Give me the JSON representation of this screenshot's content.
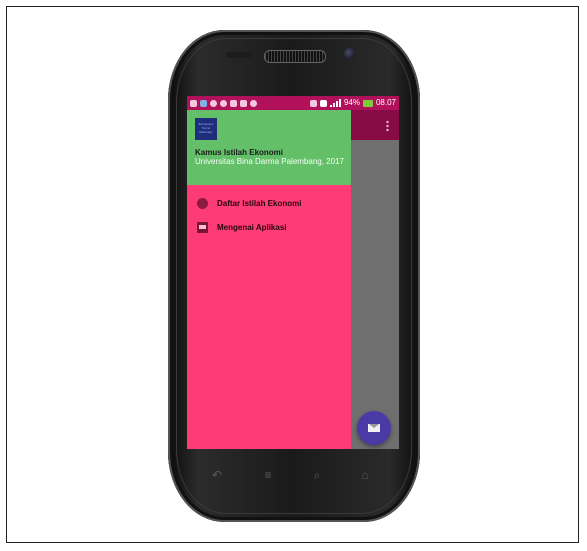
{
  "status_bar": {
    "battery": "94%",
    "time": "08.07",
    "icons": [
      "message-icon",
      "app-icon",
      "chat-icon",
      "bubble-icon",
      "mail-icon",
      "mail-icon",
      "instagram-icon",
      "vibrate-icon",
      "hd-icon",
      "signal-icon",
      "battery-icon"
    ]
  },
  "drawer": {
    "header": {
      "logo_text": "Economics Terms Dictionary",
      "title": "Kamus Istilah Ekonomi",
      "subtitle": "Universitas Bina Darma Palembang, 2017"
    },
    "menu": [
      {
        "label": "Daftar Istilah Ekonomi",
        "icon": "circle-icon"
      },
      {
        "label": "Mengenai Aplikasi",
        "icon": "image-icon"
      }
    ]
  },
  "colors": {
    "status_bar": "#b0115a",
    "app_bar": "#870c46",
    "drawer_header": "#64bf69",
    "drawer_body": "#fd3c76",
    "fab": "#4a3aa6"
  }
}
